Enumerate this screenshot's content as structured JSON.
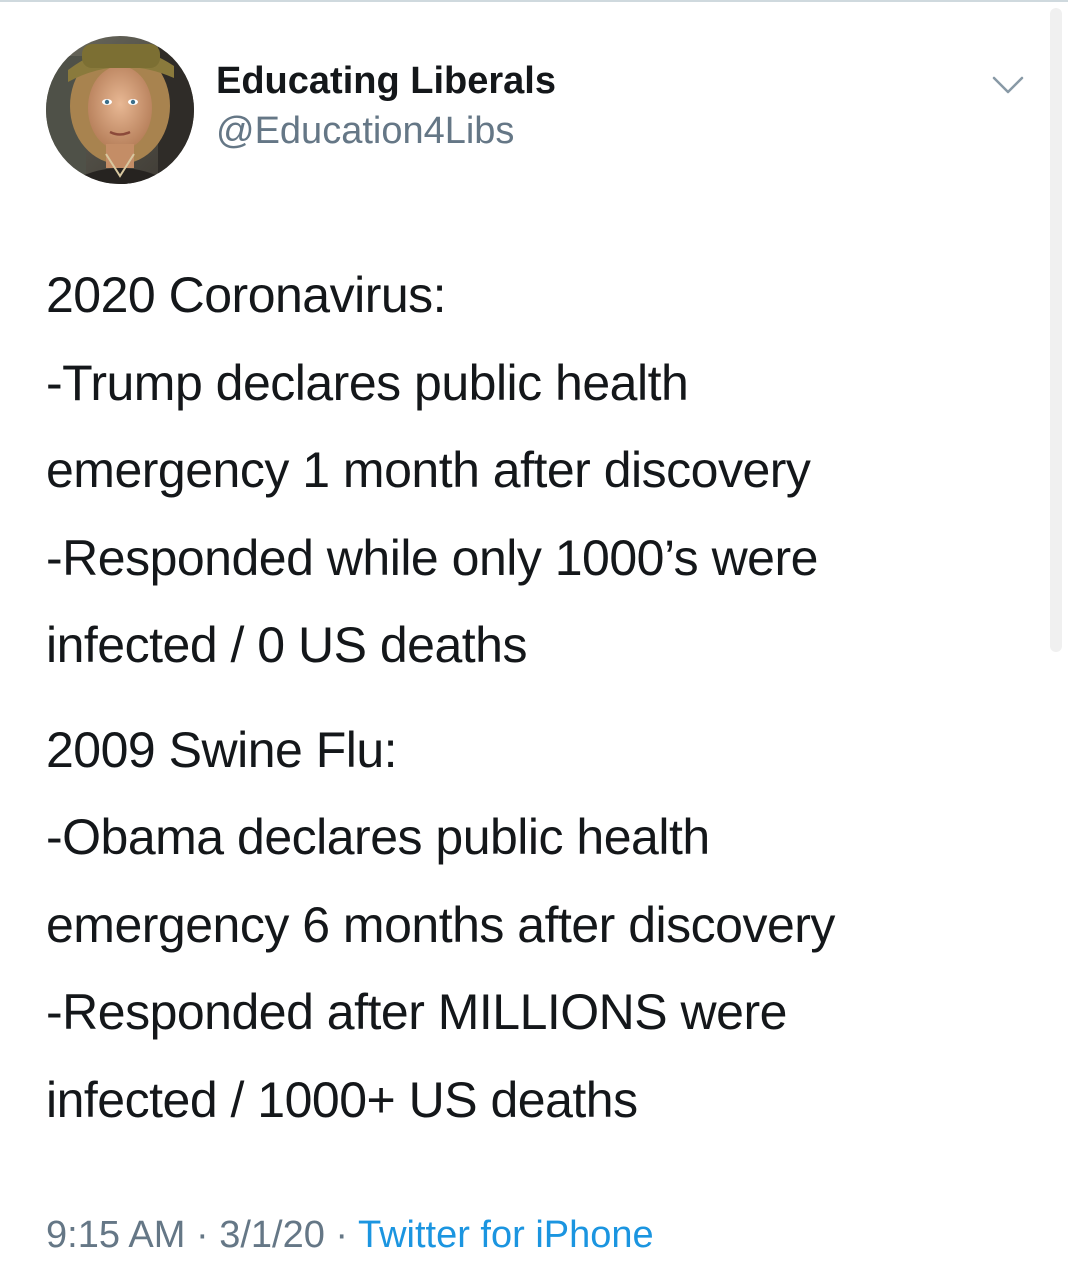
{
  "tweet": {
    "author": {
      "display_name": "Educating Liberals",
      "handle": "@Education4Libs"
    },
    "paragraphs": [
      {
        "lines": [
          "2020 Coronavirus:",
          "-Trump declares public health",
          "emergency 1 month after discovery",
          "-Responded while only 1000’s were",
          "infected / 0 US deaths"
        ]
      },
      {
        "lines": [
          "2009 Swine Flu:",
          "-Obama declares public health",
          "emergency 6 months after discovery",
          "-Responded after MILLIONS were",
          "infected / 1000+ US deaths"
        ]
      }
    ],
    "meta": {
      "time": "9:15 AM",
      "separator_1": " · ",
      "date": "3/1/20",
      "separator_2": " · ",
      "source": "Twitter for iPhone"
    }
  },
  "icons": {
    "menu": "chevron-down-icon",
    "avatar": "avatar"
  },
  "colors": {
    "text": "#14171a",
    "secondary": "#657786",
    "link": "#1b95e0",
    "divider": "#cfd9de"
  }
}
